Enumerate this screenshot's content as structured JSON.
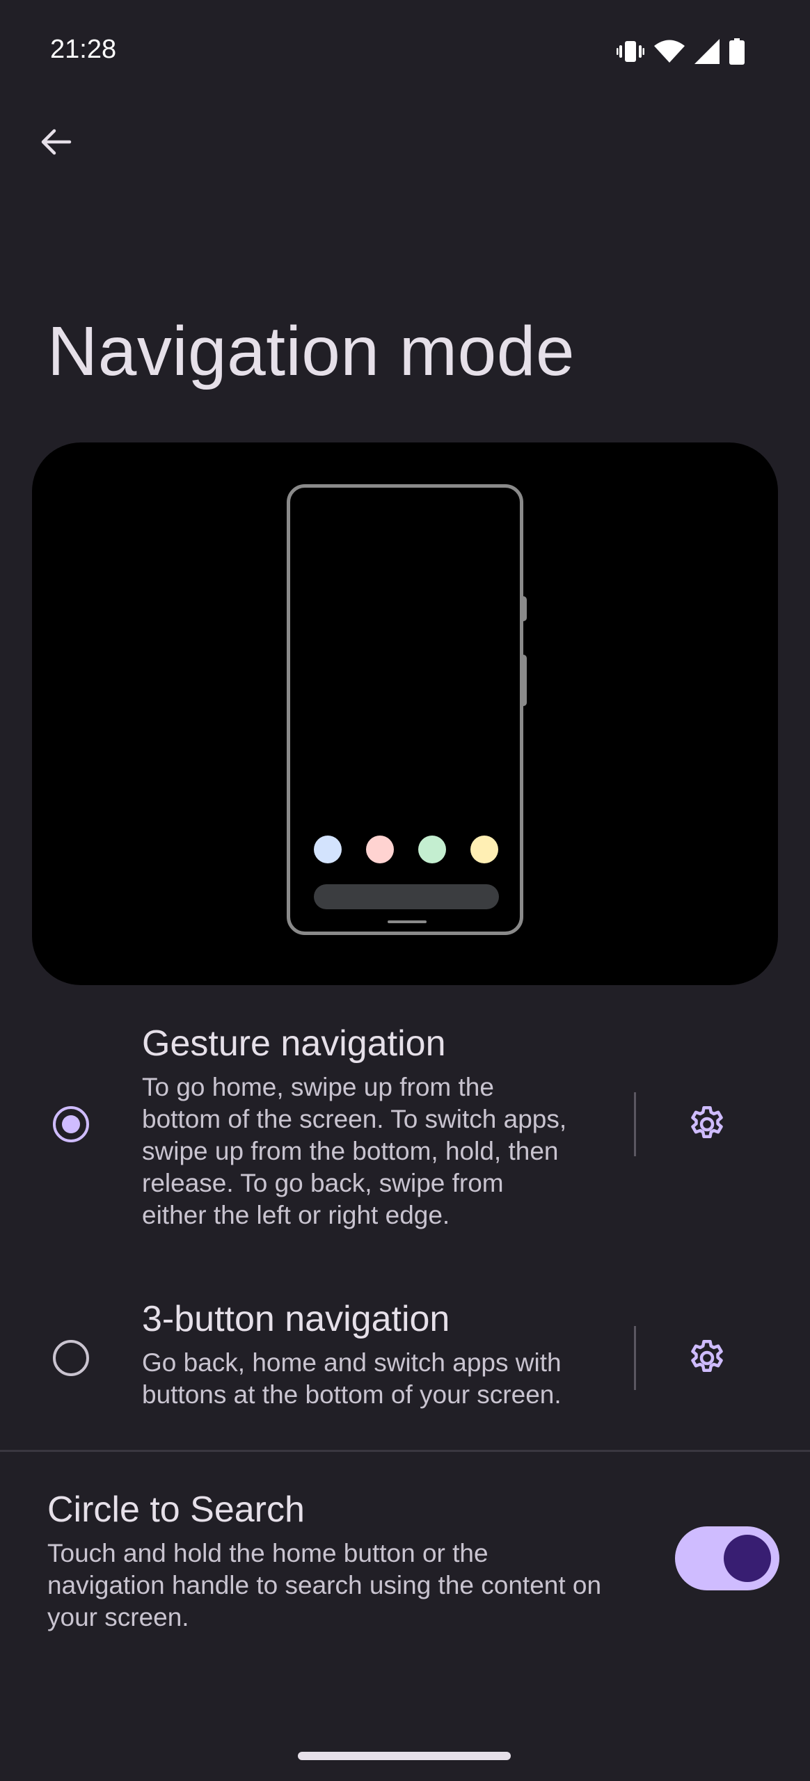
{
  "status_bar": {
    "time": "21:28",
    "icons": [
      "vibrate-icon",
      "wifi-icon",
      "signal-icon",
      "battery-icon"
    ]
  },
  "header": {
    "back_icon": "arrow-back-icon",
    "title": "Navigation mode"
  },
  "preview": {
    "dot_colors": [
      "#d3e3fd",
      "#ffd3d1",
      "#c4eed0",
      "#ffefb4"
    ]
  },
  "options": [
    {
      "title": "Gesture navigation",
      "description_lines": [
        "To go home, swipe up from the",
        "bottom of the screen. To switch apps,",
        "swipe up from the bottom, hold, then",
        "release. To go back, swipe from",
        "either the left or right edge."
      ],
      "selected": true,
      "settings_icon": "gear-icon"
    },
    {
      "title": "3-button navigation",
      "description_lines": [
        "Go back, home and switch apps with",
        "buttons at the bottom of your screen."
      ],
      "selected": false,
      "settings_icon": "gear-icon"
    }
  ],
  "circle_to_search": {
    "title": "Circle to Search",
    "description_lines": [
      "Touch and hold the home button or the",
      "navigation handle to search using the content on",
      "your screen."
    ],
    "enabled": true
  },
  "colors": {
    "background": "#211f26",
    "accent": "#cfbcff",
    "accent_dark": "#381e72"
  }
}
